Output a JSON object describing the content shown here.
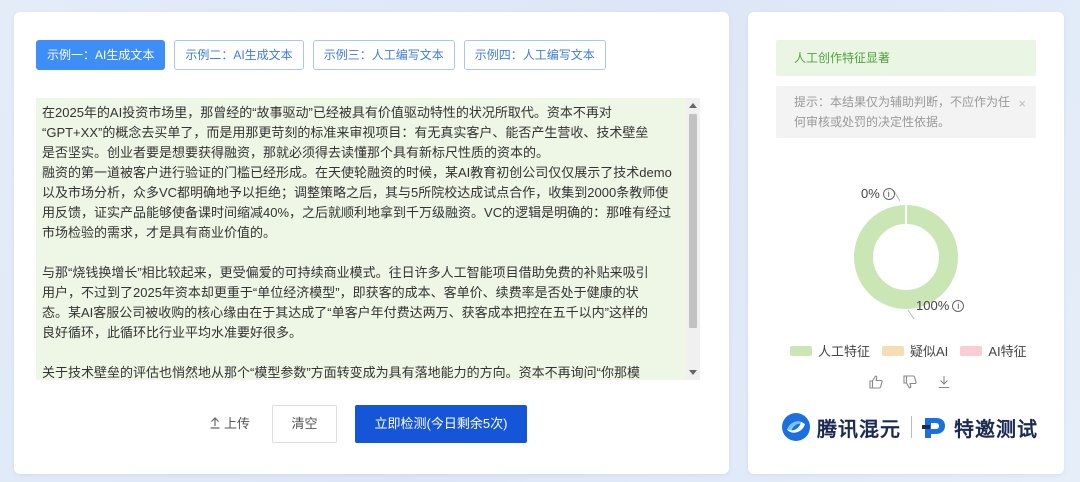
{
  "tabs": [
    {
      "label": "示例一：AI生成文本",
      "active": true
    },
    {
      "label": "示例二：AI生成文本",
      "active": false
    },
    {
      "label": "示例三：人工编写文本",
      "active": false
    },
    {
      "label": "示例四：人工编写文本",
      "active": false
    }
  ],
  "editor": {
    "text": "在2025年的AI投资市场里，那曾经的“故事驱动”已经被具有价值驱动特性的状况所取代。资本不再对\n“GPT+XX”的概念去买单了，而是用那更苛刻的标准来审视项目：有无真实客户、能否产生营收、技术壁垒\n是否坚实。创业者要是想要获得融资，那就必须得去读懂那个具有新标尺性质的资本的。\n融资的第一道被客户进行验证的门槛已经形成。在天使轮融资的时候，某AI教育初创公司仅仅展示了技术demo\n以及市场分析，众多VC都明确地予以拒绝；调整策略之后，其与5所院校达成试点合作，收集到2000条教师使\n用反馈，证实产品能够使备课时间缩减40%，之后就顺利地拿到千万级融资。VC的逻辑是明确的：那唯有经过\n市场检验的需求，才是具有商业价值的。\n\n与那“烧钱换增长”相比较起来，更受偏爱的可持续商业模式。往日许多人工智能项目借助免费的补贴来吸引\n用户，不过到了2025年资本却更重于“单位经济模型”，即获客的成本、客单价、续费率是否处于健康的状\n态。某AI客服公司被收购的核心缘由在于其达成了“单客户年付费达两万、获客成本把控在五千以内”这样的\n良好循环，此循环比行业平均水准要好很多。\n\n关于技术壁垒的评估也悄然地从那个“模型参数”方面转变成为具有落地能力的方向。资本不再询问“你那模"
  },
  "actions": {
    "upload": "上传",
    "clear": "清空",
    "detect": "立即检测(今日剩余5次)"
  },
  "result": {
    "title": "人工创作特征显著",
    "notice": "提示：本结果仅为辅助判断，不应作为任何审核或处罚的决定性依据。",
    "close_icon": "×",
    "info_icon": "i",
    "pct_low_label": "0%",
    "pct_high_label": "100%"
  },
  "chart_data": {
    "type": "pie",
    "categories": [
      "人工特征",
      "疑似AI",
      "AI特征"
    ],
    "values": [
      100,
      0,
      0
    ],
    "colors": [
      "#c9e6b4",
      "#f6ddb5",
      "#f9cdd3"
    ],
    "legend": "bottom",
    "donut": true
  },
  "brand": {
    "name": "腾讯混元",
    "sub": "特邀测试"
  }
}
